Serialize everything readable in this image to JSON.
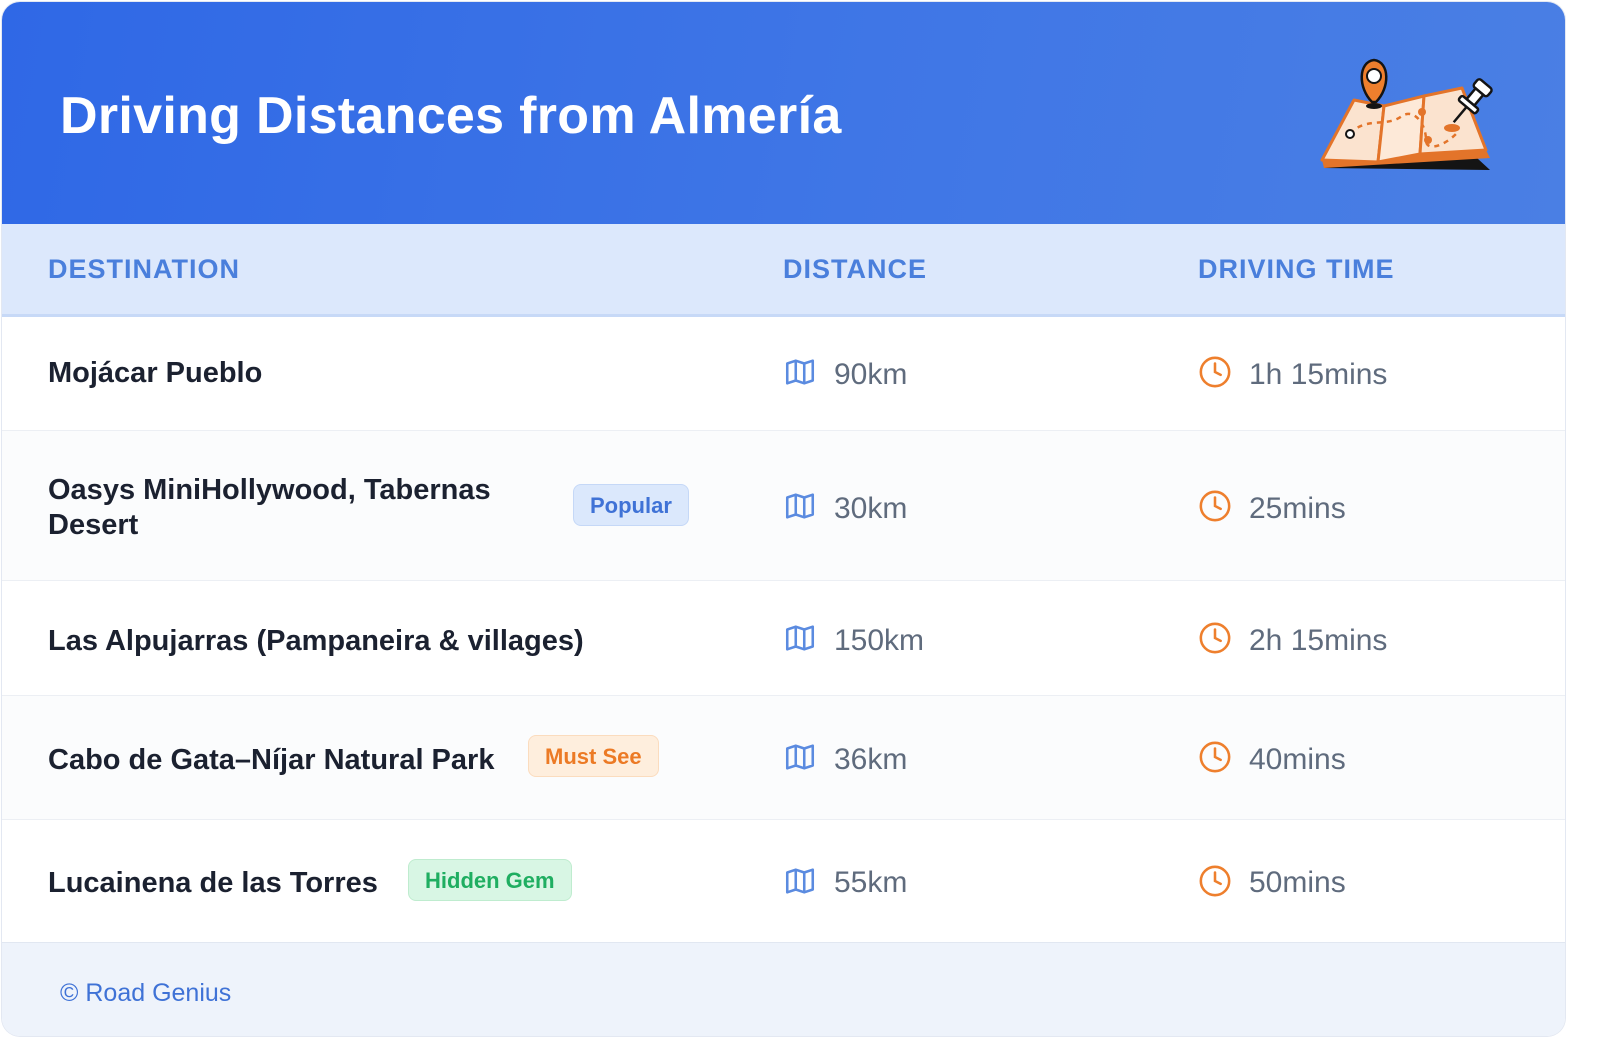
{
  "header": {
    "title": "Driving Distances from Almería",
    "illustration": "map-pin-icon"
  },
  "columns": {
    "destination": "DESTINATION",
    "distance": "DISTANCE",
    "driving_time": "DRIVING TIME"
  },
  "rows": [
    {
      "destination": "Mojácar Pueblo",
      "badge": "",
      "distance": "90km",
      "time": "1h 15mins"
    },
    {
      "destination": "Oasys MiniHollywood, Tabernas Desert",
      "badge": "Popular",
      "distance": "30km",
      "time": "25mins"
    },
    {
      "destination": "Las Alpujarras (Pampaneira & villages)",
      "badge": "",
      "distance": "150km",
      "time": "2h 15mins"
    },
    {
      "destination": "Cabo de Gata–Níjar Natural Park",
      "badge": "Must See",
      "distance": "36km",
      "time": "40mins"
    },
    {
      "destination": "Lucainena de las Torres",
      "badge": "Hidden Gem",
      "distance": "55km",
      "time": "50mins"
    }
  ],
  "footer": {
    "credit": "© Road Genius"
  },
  "colors": {
    "header_blue": "#2f68e6",
    "header_text_accent": "#4a7fdc",
    "icon_blue": "#5b8be0",
    "icon_orange": "#ee7f2d",
    "popular_badge": "#3f72d6",
    "must_see_badge": "#ec7a25",
    "hidden_gem_badge": "#1fae61"
  }
}
